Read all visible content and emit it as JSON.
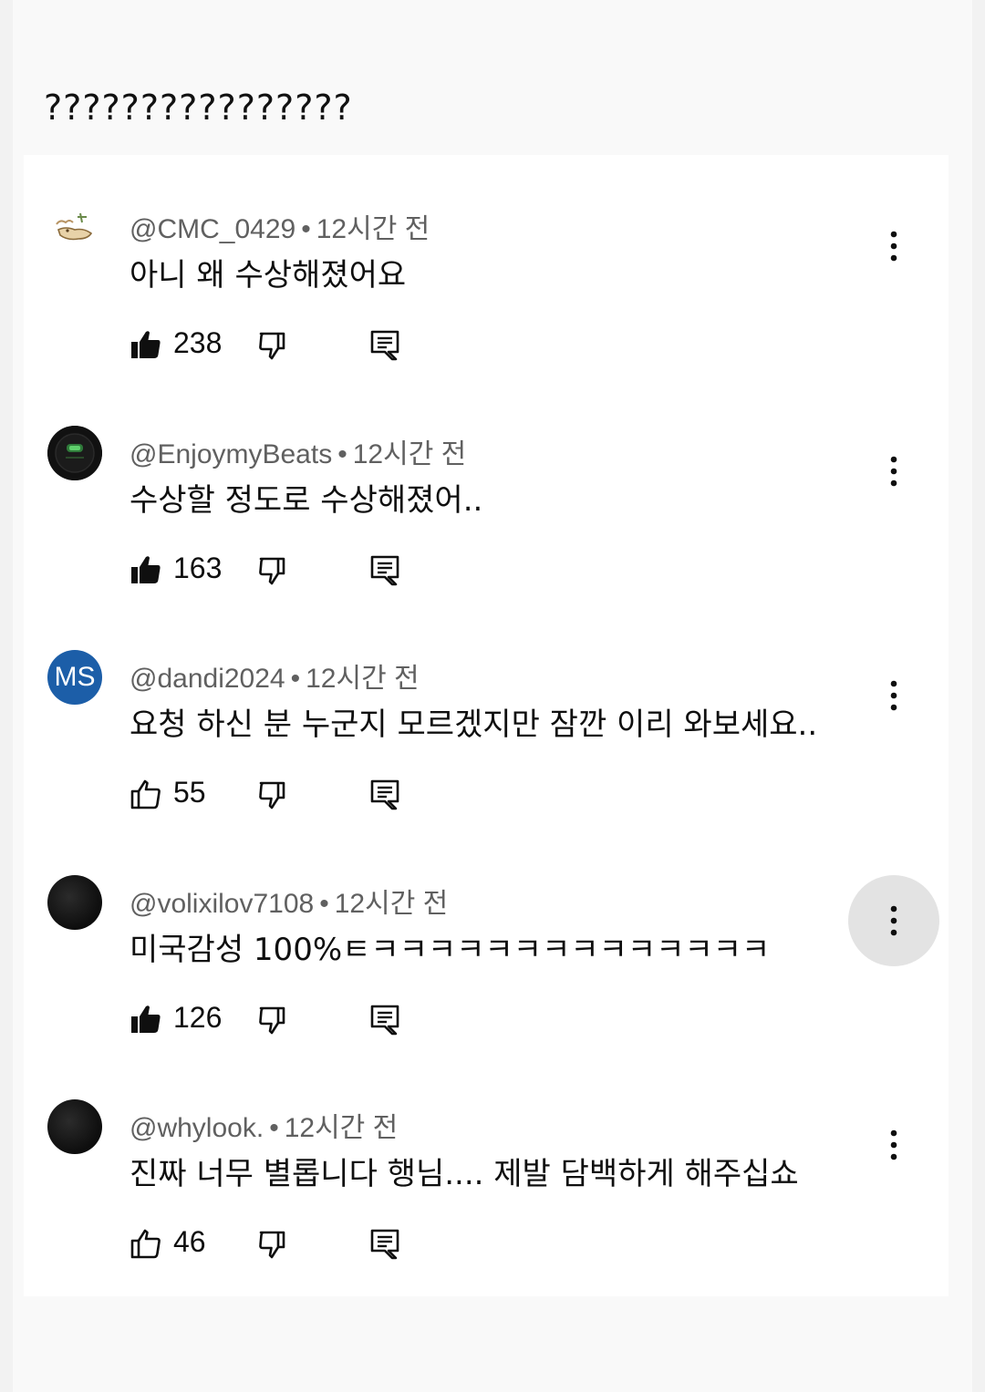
{
  "heading": "????????????????",
  "comments": [
    {
      "author": "@CMC_0429",
      "time": "12시간 전",
      "text": "아니 왜 수상해졌어요",
      "likes": "238",
      "liked": true,
      "avatar": "sketch"
    },
    {
      "author": "@EnjoymyBeats",
      "time": "12시간 전",
      "text": "수상할 정도로 수상해졌어..",
      "likes": "163",
      "liked": true,
      "avatar": "dark"
    },
    {
      "author": "@dandi2024",
      "time": "12시간 전",
      "text": "요청 하신 분 누군지 모르겠지만 잠깐 이리 와보세요..",
      "likes": "55",
      "liked": false,
      "avatar": "MS"
    },
    {
      "author": "@volixilov7108",
      "time": "12시간 전",
      "text": "미국감성 100%ㅌㅋㅋㅋㅋㅋㅋㅋㅋㅋㅋㅋㅋㅋㅋ",
      "likes": "126",
      "liked": true,
      "avatar": "dark"
    },
    {
      "author": "@whylook.",
      "time": "12시간 전",
      "text": "진짜 너무 별롭니다 행님.... 제발 담백하게 해주십쇼",
      "likes": "46",
      "liked": false,
      "avatar": "dark"
    }
  ],
  "colors": {
    "meta": "#606060",
    "text": "#0f0f0f",
    "ms_avatar": "#1c5ea8",
    "menu_highlight": "#e3e3e3"
  },
  "icons": {
    "like_filled": "thumb-up-filled-icon",
    "like_outline": "thumb-up-outline-icon",
    "dislike": "thumb-down-outline-icon",
    "reply": "reply-comment-icon",
    "more": "more-vertical-icon"
  },
  "ui_state": {
    "highlighted_menu_comment": 3
  }
}
